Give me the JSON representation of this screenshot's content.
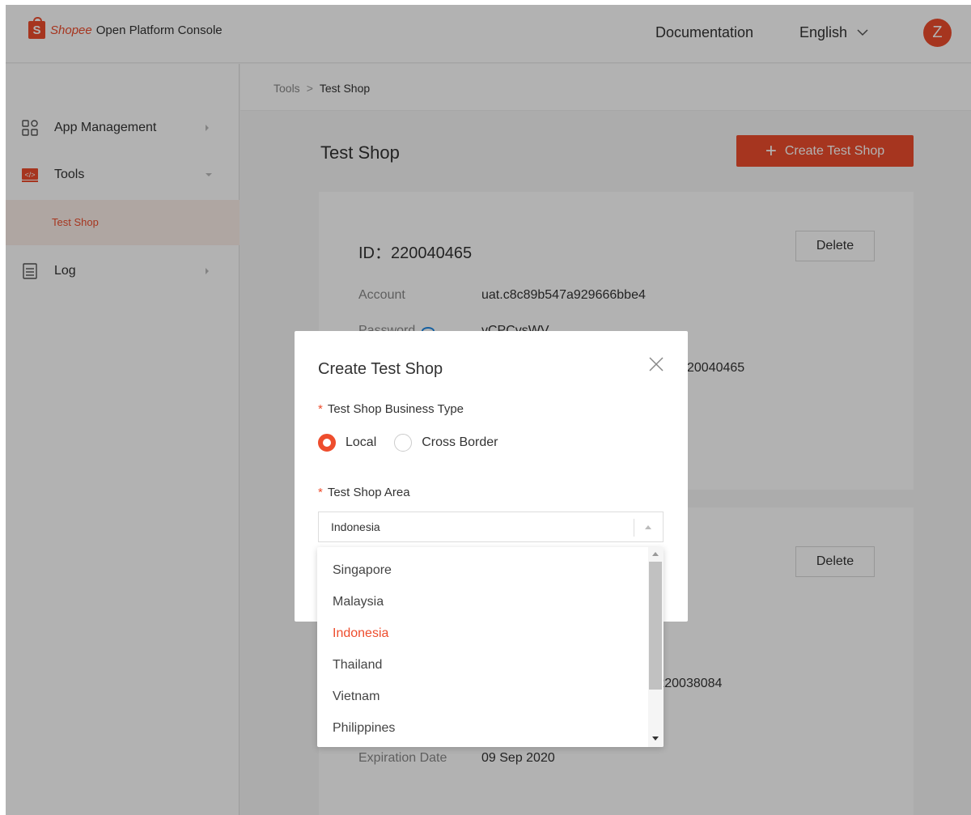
{
  "header": {
    "logo_brand": "Shopee",
    "logo_suffix": "Open Platform Console",
    "documentation": "Documentation",
    "language": "English",
    "avatar_initial": "Z"
  },
  "sidebar": {
    "items": [
      {
        "label": "App Management",
        "icon": "grid-icon"
      },
      {
        "label": "Tools",
        "icon": "code-icon"
      },
      {
        "label": "Log",
        "icon": "document-icon"
      }
    ],
    "sub_item": "Test Shop"
  },
  "breadcrumb": {
    "parent": "Tools",
    "separator": ">",
    "current": "Test Shop"
  },
  "page": {
    "title": "Test Shop",
    "create_button": "Create Test Shop"
  },
  "cards": [
    {
      "id": "ID：220040465",
      "delete": "Delete",
      "account_label": "Account",
      "account_value": "uat.c8c89b547a929666bbe4",
      "password_label": "Password",
      "password_value": "vCPCvsWV",
      "shop_link_partial": "20040465"
    },
    {
      "delete": "Delete",
      "shop_link_partial": "p/220038084",
      "expiration_label": "Expiration Date",
      "expiration_value": "09 Sep 2020"
    }
  ],
  "modal": {
    "title": "Create Test Shop",
    "business_type_label": "Test Shop Business Type",
    "required_mark": "*",
    "options": [
      "Local",
      "Cross Border"
    ],
    "selected_option": "Local",
    "area_label": "Test Shop Area",
    "area_value": "Indonesia"
  },
  "dropdown": {
    "options": [
      "Singapore",
      "Malaysia",
      "Indonesia",
      "Thailand",
      "Vietnam",
      "Philippines"
    ],
    "selected": "Indonesia"
  },
  "colors": {
    "accent": "#ee4d2d",
    "selected_bg": "#fbeee9"
  }
}
